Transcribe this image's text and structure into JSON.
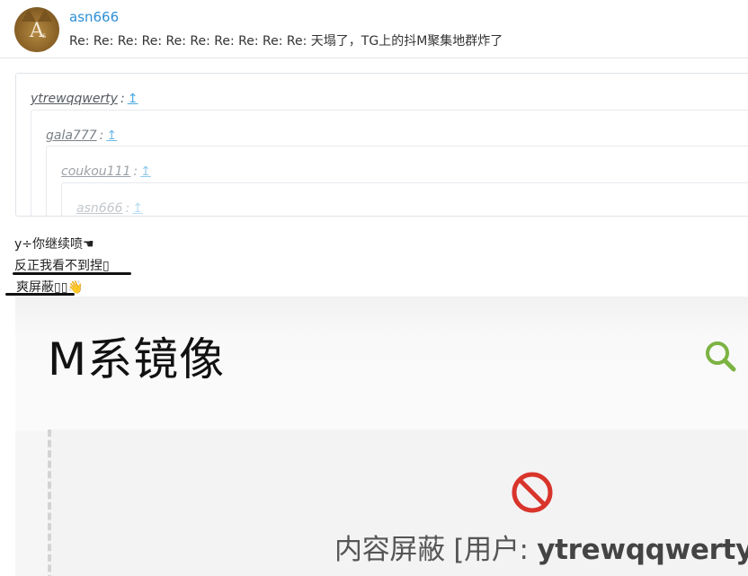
{
  "post": {
    "avatar_letter": "A",
    "avatar_small": "s",
    "username": "asn666",
    "title": "Re: Re: Re: Re: Re: Re: Re: Re: Re: Re: 天塌了，TG上的抖M聚集地群炸了"
  },
  "quotes": [
    {
      "user": "ytrewqqwerty",
      "sep": ":",
      "arrow": "↥",
      "color": "#555a60",
      "arrow_color": "#4aa8e0"
    },
    {
      "user": "gala777",
      "sep": ":",
      "arrow": "↥",
      "color": "#7b8085",
      "arrow_color": "#6bb8e6"
    },
    {
      "user": "coukou111",
      "sep": ":",
      "arrow": "↥",
      "color": "#9da2a7",
      "arrow_color": "#8fc9ec"
    },
    {
      "user": "asn666",
      "sep": ":",
      "arrow": "↥",
      "color": "#c3c7cb",
      "arrow_color": "#b7dcf2"
    }
  ],
  "reply": {
    "line1": "y÷你继续喷☚",
    "line2": "反正我看不到捏▯",
    "line3": "爽屏蔽▯▯👋"
  },
  "embed": {
    "title": "M系镜像",
    "blocked_prefix": "内容屏蔽 [用户: ",
    "blocked_user": "ytrewqqwerty",
    "blocked_suffix": "]",
    "search_icon": "search-icon",
    "ban_icon": "prohibited-icon",
    "search_color": "#7cb342",
    "ban_color": "#d9342b"
  }
}
